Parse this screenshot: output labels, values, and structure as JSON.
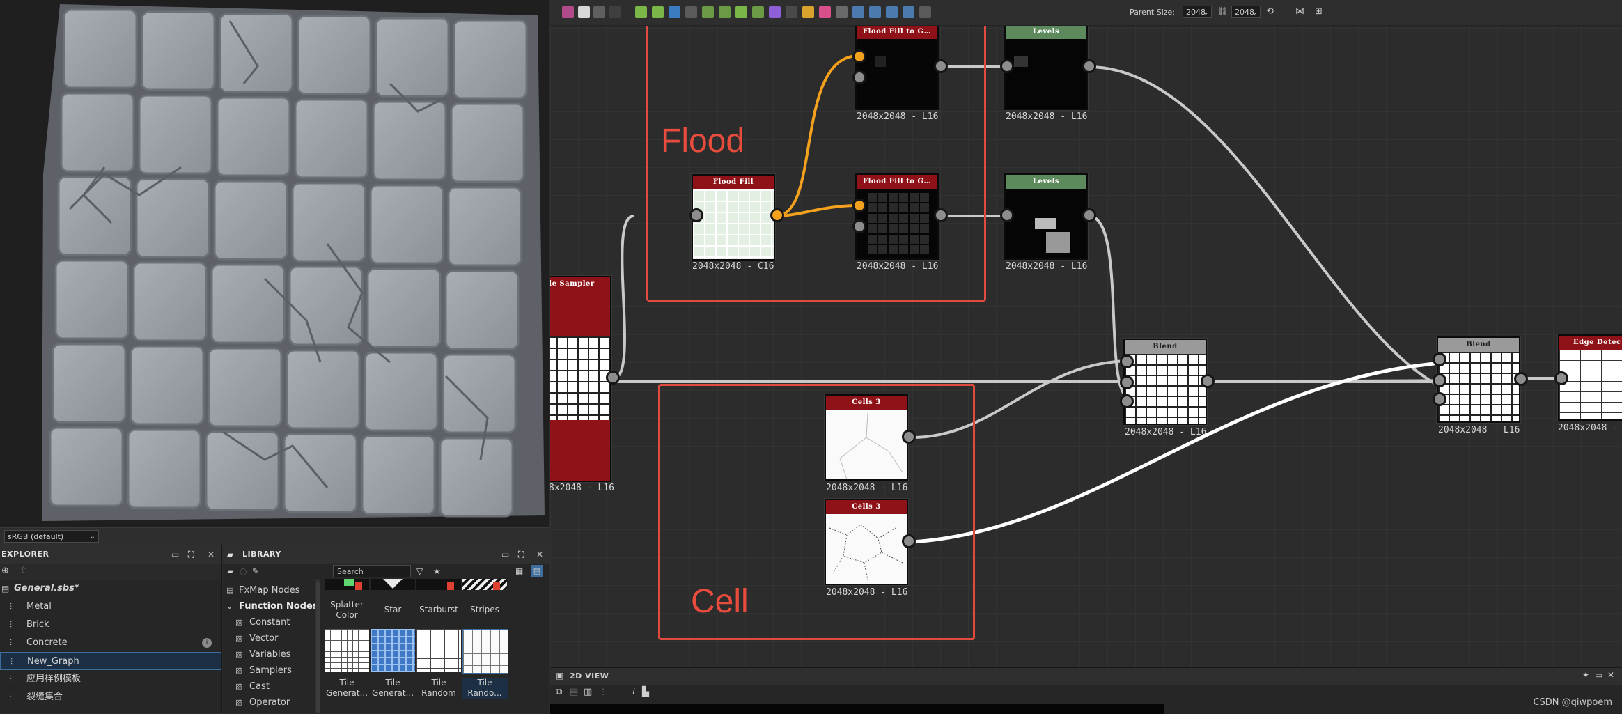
{
  "viewport": {
    "colorspace": "sRGB (default)"
  },
  "explorer": {
    "title": "EXPLORER",
    "file": "General.sbs*",
    "items": [
      {
        "label": "Metal"
      },
      {
        "label": "Brick"
      },
      {
        "label": "Concrete"
      },
      {
        "label": "New_Graph"
      },
      {
        "label": "应用样例模板"
      },
      {
        "label": "裂缝集合"
      }
    ]
  },
  "library": {
    "title": "LIBRARY",
    "search_placeholder": "Search",
    "categories": [
      {
        "label": "FxMap Nodes",
        "bold": false
      },
      {
        "label": "Function Nodes",
        "bold": true
      },
      {
        "label": "Constant",
        "bold": false
      },
      {
        "label": "Vector",
        "bold": false
      },
      {
        "label": "Variables",
        "bold": false
      },
      {
        "label": "Samplers",
        "bold": false
      },
      {
        "label": "Cast",
        "bold": false
      },
      {
        "label": "Operator",
        "bold": false
      }
    ],
    "row1_labels": [
      "Splatter\nColor",
      "Star",
      "Starburst",
      "Stripes"
    ],
    "row2_labels": [
      "Tile\nGenerat...",
      "Tile\nGenerat...",
      "Tile\nRandom",
      "Tile\nRando..."
    ]
  },
  "graph": {
    "toolbar": {
      "parent_size_label": "Parent Size:",
      "size_a": "2048",
      "size_b": "2048"
    },
    "frames": [
      {
        "label": "Flood"
      },
      {
        "label": "Cell"
      }
    ],
    "nodes": {
      "tile_sampler": {
        "title": "ile Sampler",
        "res": "8x2048 - L16"
      },
      "flood_fill": {
        "title": "Flood Fill",
        "res": "2048x2048 - C16"
      },
      "ff_gray_1": {
        "title": "Flood Fill to G…",
        "res": "2048x2048 - L16"
      },
      "ff_gray_2": {
        "title": "Flood Fill to G…",
        "res": "2048x2048 - L16"
      },
      "levels_1": {
        "title": "Levels",
        "res": "2048x2048 - L16"
      },
      "levels_2": {
        "title": "Levels",
        "res": "2048x2048 - L16"
      },
      "cells_1": {
        "title": "Cells 3",
        "res": "2048x2048 - L16"
      },
      "cells_2": {
        "title": "Cells 3",
        "res": "2048x2048 - L16"
      },
      "blend_1": {
        "title": "Blend",
        "res": "2048x2048 - L16"
      },
      "blend_2": {
        "title": "Blend",
        "res": "2048x2048 - L16"
      },
      "edge_detect": {
        "title": "Edge Detec",
        "res": "2048x2048 -"
      }
    },
    "colors": {
      "red_title": "#8e1217",
      "green_title": "#5c8a5c",
      "gray_title": "#9a9a9a",
      "frame": "#e04a3f",
      "orange_wire": "#f4a11d"
    }
  },
  "view2d": {
    "title": "2D VIEW"
  },
  "watermark": "CSDN @qiwpoem"
}
